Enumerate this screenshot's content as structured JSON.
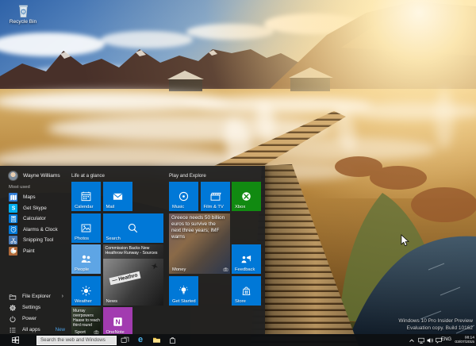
{
  "desktop": {
    "recycle_bin": {
      "label": "Recycle Bin"
    },
    "watermark": {
      "line1": "Windows 10 Pro Insider Preview",
      "line2": "Evaluation copy. Build 10162"
    }
  },
  "start_menu": {
    "user": {
      "name": "Wayne Williams"
    },
    "most_used_header": "Most used",
    "most_used": [
      {
        "label": "Maps",
        "icon": "maps-icon",
        "color": "#2f7cd6"
      },
      {
        "label": "Get Skype",
        "icon": "skype-icon",
        "color": "#00aff0"
      },
      {
        "label": "Calculator",
        "icon": "calculator-icon",
        "color": "#0078d7"
      },
      {
        "label": "Alarms & Clock",
        "icon": "alarms-icon",
        "color": "#0078d7"
      },
      {
        "label": "Snipping Tool",
        "icon": "snipping-icon",
        "color": "#4a7ab5"
      },
      {
        "label": "Paint",
        "icon": "paint-icon",
        "color": "#b06a3a"
      }
    ],
    "footer_items": [
      {
        "label": "File Explorer",
        "icon": "file-explorer-icon",
        "chevron": "›"
      },
      {
        "label": "Settings",
        "icon": "settings-icon"
      },
      {
        "label": "Power",
        "icon": "power-icon"
      },
      {
        "label": "All apps",
        "icon": "all-apps-icon",
        "trailing": "New"
      }
    ],
    "groups": [
      {
        "title": "Life at a glance",
        "tiles": [
          {
            "name": "calendar",
            "label": "Calendar",
            "icon": "calendar-icon",
            "color": "#0078d7",
            "col": 0,
            "row": 0,
            "size": "med"
          },
          {
            "name": "mail",
            "label": "Mail",
            "icon": "mail-icon",
            "color": "#0078d7",
            "col": 1,
            "row": 0,
            "size": "med"
          },
          {
            "name": "photos",
            "label": "Photos",
            "icon": "photos-icon",
            "color": "#0078d7",
            "col": 0,
            "row": 1,
            "size": "med"
          },
          {
            "name": "search",
            "label": "Search",
            "icon": "search-icon",
            "color": "#0078d7",
            "col": 1,
            "row": 1,
            "size": "wide"
          },
          {
            "name": "people",
            "label": "People",
            "icon": "people-icon",
            "color": "#5ea5e5",
            "col": 0,
            "row": 2,
            "size": "med"
          },
          {
            "name": "news",
            "label": "News",
            "photo": "news",
            "headline": "Commission Backs New Heathrow Runway - Sources",
            "sign_text": "— Heathro",
            "col": 1,
            "row": 2,
            "size": "large"
          },
          {
            "name": "weather",
            "label": "Weather",
            "icon": "weather-icon",
            "color": "#0078d7",
            "col": 0,
            "row": 3,
            "size": "med"
          },
          {
            "name": "sport",
            "label": "Sport",
            "photo": "sport",
            "headline": "Murray overpowers Haase to reach third round",
            "col": 0,
            "row": 4,
            "size": "med"
          },
          {
            "name": "onenote",
            "label": "OneNote",
            "icon": "onenote-icon",
            "color": "#a23bb0",
            "col": 1,
            "row": 4,
            "size": "med"
          }
        ]
      },
      {
        "title": "Play and Explore",
        "tiles": [
          {
            "name": "music",
            "label": "Music",
            "icon": "music-icon",
            "color": "#0078d7",
            "col": 0,
            "row": 0,
            "size": "med"
          },
          {
            "name": "film-tv",
            "label": "Film & TV",
            "icon": "film-icon",
            "color": "#0078d7",
            "col": 1,
            "row": 0,
            "size": "med"
          },
          {
            "name": "xbox",
            "label": "Xbox",
            "icon": "xbox-icon",
            "color": "#118a11",
            "col": 2,
            "row": 0,
            "size": "med"
          },
          {
            "name": "money",
            "label": "Money",
            "photo": "money",
            "headline": "Greece needs 50 billion euros to survive the next three years; IMF warns",
            "col": 0,
            "row": 1,
            "size": "large"
          },
          {
            "name": "feedback",
            "label": "Feedback",
            "icon": "feedback-icon",
            "color": "#0078d7",
            "col": 2,
            "row": 2,
            "size": "med"
          },
          {
            "name": "get-started",
            "label": "Get Started",
            "icon": "getstarted-icon",
            "color": "#0078d7",
            "col": 0,
            "row": 3,
            "size": "med"
          },
          {
            "name": "store",
            "label": "Store",
            "icon": "store-icon",
            "color": "#0078d7",
            "col": 2,
            "row": 3,
            "size": "med"
          }
        ]
      }
    ]
  },
  "taskbar": {
    "search": {
      "placeholder": "Search the web and Windows"
    },
    "buttons": [
      {
        "name": "task-view",
        "icon": "taskview-icon"
      },
      {
        "name": "edge",
        "icon": "edge-icon"
      },
      {
        "name": "file-explorer",
        "icon": "folder-icon"
      },
      {
        "name": "store",
        "icon": "storebag-icon"
      }
    ],
    "tray": {
      "language": "ENG",
      "time": "08:14",
      "date": "03/07/2015"
    }
  },
  "colors": {
    "accent": "#0078d7",
    "xbox_green": "#118a11",
    "people_blue": "#5ea5e5",
    "onenote_purple": "#a23bb0",
    "taskbar": "#0e1013"
  }
}
